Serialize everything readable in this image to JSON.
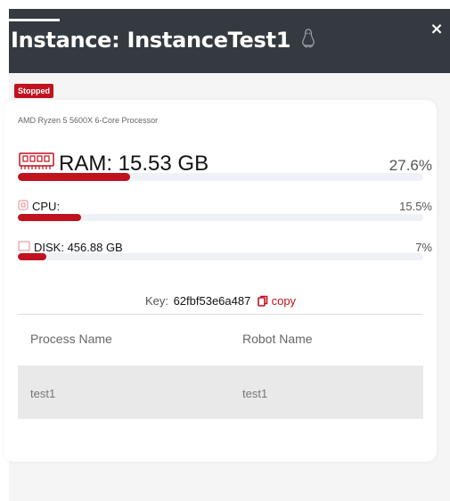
{
  "header": {
    "title": "Instance: InstanceTest1",
    "os_icon": "linux-tux-icon",
    "close_label": "×"
  },
  "status": {
    "label": "Stopped",
    "color": "#c1121f"
  },
  "processor": "AMD Ryzen 5 5600X 6-Core Processor",
  "metrics": {
    "ram": {
      "label": "RAM: 15.53 GB",
      "percent_label": "27.6%",
      "percent": 27.6,
      "icon": "memory-icon"
    },
    "cpu": {
      "label": "CPU:",
      "percent_label": "15.5%",
      "percent": 15.5,
      "icon": "cpu-icon"
    },
    "disk": {
      "label": "DISK: 456.88 GB",
      "percent_label": "7%",
      "percent": 7,
      "icon": "disk-icon"
    }
  },
  "key": {
    "label": "Key:",
    "value": "62fbf53e6a487",
    "copy_label": "copy",
    "copy_icon": "copy-icon"
  },
  "table": {
    "columns": [
      "Process Name",
      "Robot Name"
    ],
    "rows": [
      [
        "test1",
        "test1"
      ]
    ]
  },
  "colors": {
    "accent": "#c1121f",
    "header_bg": "#343a40"
  }
}
